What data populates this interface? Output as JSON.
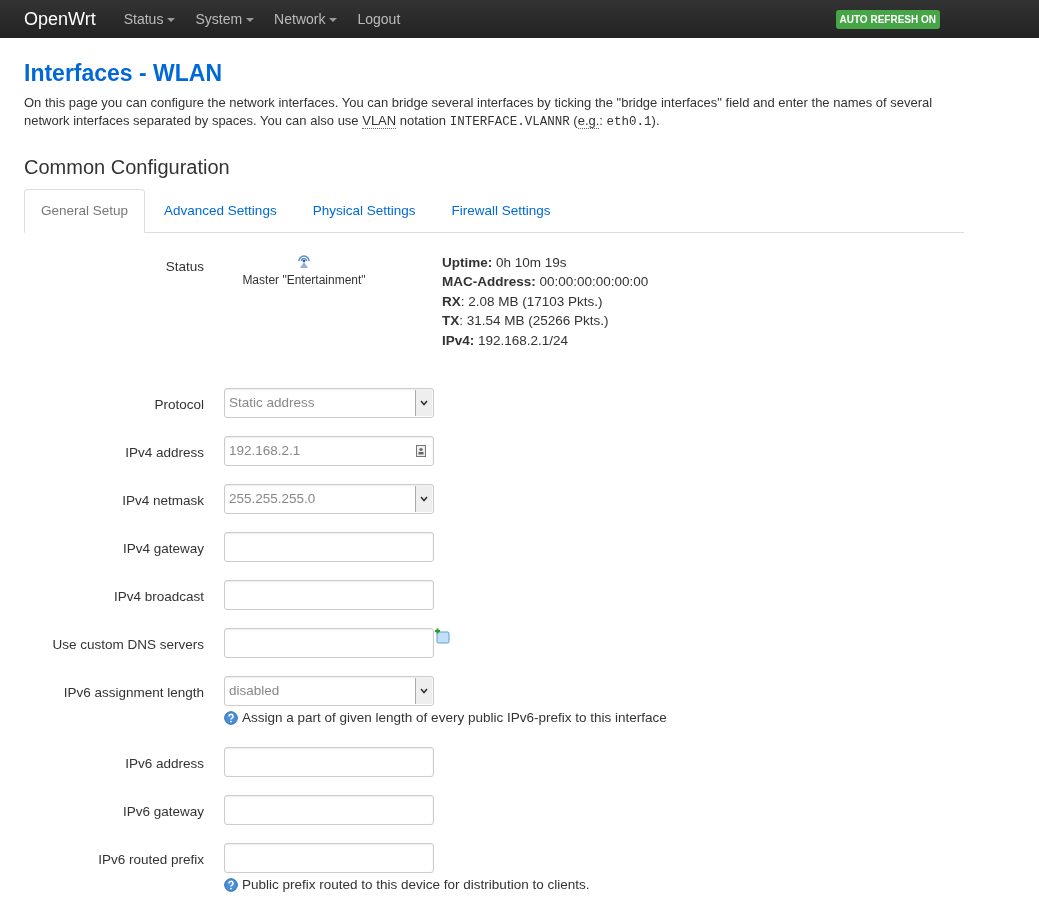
{
  "navbar": {
    "brand": "OpenWrt",
    "menus": [
      {
        "label": "Status",
        "dropdown": true
      },
      {
        "label": "System",
        "dropdown": true
      },
      {
        "label": "Network",
        "dropdown": true
      },
      {
        "label": "Logout",
        "dropdown": false
      }
    ],
    "badge": "AUTO REFRESH ON"
  },
  "page": {
    "title": "Interfaces - WLAN",
    "description": [
      {
        "kind": "text",
        "text": "On this page you can configure the network interfaces. You can bridge several interfaces by ticking the \"bridge interfaces\" field and enter the names of several network interfaces separated by spaces. You can also use "
      },
      {
        "kind": "abbr",
        "text": "VLAN"
      },
      {
        "kind": "text",
        "text": " notation "
      },
      {
        "kind": "code",
        "text": "INTERFACE.VLANNR"
      },
      {
        "kind": "text",
        "text": " ("
      },
      {
        "kind": "abbr",
        "text": "e.g."
      },
      {
        "kind": "text",
        "text": ": "
      },
      {
        "kind": "code",
        "text": "eth0.1"
      },
      {
        "kind": "text",
        "text": ")."
      }
    ]
  },
  "section": {
    "title": "Common Configuration",
    "tabs": [
      {
        "label": "General Setup",
        "selected": true
      },
      {
        "label": "Advanced Settings",
        "selected": false
      },
      {
        "label": "Physical Settings",
        "selected": false
      },
      {
        "label": "Firewall Settings",
        "selected": false
      }
    ],
    "status": {
      "label": "Status",
      "device": "Master \"Entertainment\"",
      "lines": [
        "**Uptime:** 0h 10m 19s",
        "**MAC-Address:** 00:00:00:00:00:00",
        "**RX**: 2.08 MB (17103 Pkts.)",
        "**TX**: 31.54 MB (25266 Pkts.)",
        "**IPv4:** 192.168.2.1/24"
      ]
    },
    "fields": [
      {
        "label": "Protocol",
        "kind": "select",
        "value": "Static address"
      },
      {
        "label": "IPv4 address",
        "kind": "input-icon",
        "value": "192.168.2.1"
      },
      {
        "label": "IPv4 netmask",
        "kind": "select",
        "value": "255.255.255.0"
      },
      {
        "label": "IPv4 gateway",
        "kind": "input"
      },
      {
        "label": "IPv4 broadcast",
        "kind": "input"
      },
      {
        "label": "Use custom DNS servers",
        "kind": "dynlist"
      },
      {
        "label": "IPv6 assignment length",
        "kind": "select",
        "value": "disabled",
        "help": "Assign a part of given length of every public IPv6-prefix to this interface"
      },
      {
        "label": "IPv6 address",
        "kind": "input"
      },
      {
        "label": "IPv6 gateway",
        "kind": "input"
      },
      {
        "label": "IPv6 routed prefix",
        "kind": "input",
        "help": "Public prefix routed to this device for distribution to clients."
      }
    ]
  }
}
